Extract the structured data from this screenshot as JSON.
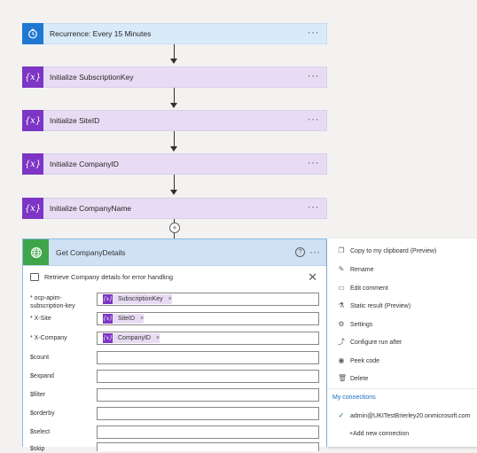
{
  "flow": {
    "steps": [
      {
        "title": "Recurrence: Every 15 Minutes",
        "kind": "recurrence"
      },
      {
        "title": "Initialize SubscriptionKey",
        "kind": "variable"
      },
      {
        "title": "Initialize SiteID",
        "kind": "variable"
      },
      {
        "title": "Initialize CompanyID",
        "kind": "variable"
      },
      {
        "title": "Initialize CompanyName",
        "kind": "variable"
      }
    ],
    "more_glyph": "···",
    "var_glyph": "{x}"
  },
  "http_action": {
    "title": "Get CompanyDetails",
    "help_glyph": "?",
    "description": "Retrieve Company details for error handling",
    "close_glyph": "✕",
    "params": [
      {
        "label": "* ocp-apim-subscription-key",
        "token": "SubscriptionKey"
      },
      {
        "label": "* X-Site",
        "token": "SiteID"
      },
      {
        "label": "* X-Company",
        "token": "CompanyID"
      },
      {
        "label": "$count",
        "token": ""
      },
      {
        "label": "$expand",
        "token": ""
      },
      {
        "label": "$filter",
        "token": ""
      },
      {
        "label": "$orderby",
        "token": ""
      },
      {
        "label": "$select",
        "token": ""
      },
      {
        "label": "$skip",
        "token": ""
      }
    ],
    "token_remove": "×"
  },
  "context_menu": {
    "items": [
      {
        "label": "Copy to my clipboard (Preview)",
        "icon": "copy-icon"
      },
      {
        "label": "Rename",
        "icon": "rename-icon"
      },
      {
        "label": "Edit comment",
        "icon": "comment-icon"
      },
      {
        "label": "Static result (Preview)",
        "icon": "flask-icon"
      },
      {
        "label": "Settings",
        "icon": "gear-icon"
      },
      {
        "label": "Configure run after",
        "icon": "run-after-icon"
      },
      {
        "label": "Peek code",
        "icon": "eye-icon"
      },
      {
        "label": "Delete",
        "icon": "trash-icon"
      }
    ],
    "connections_header": "My connections",
    "connection": "admin@UKITestBrierley20.onmicrosoft.com",
    "add_connection": "+Add new connection"
  }
}
